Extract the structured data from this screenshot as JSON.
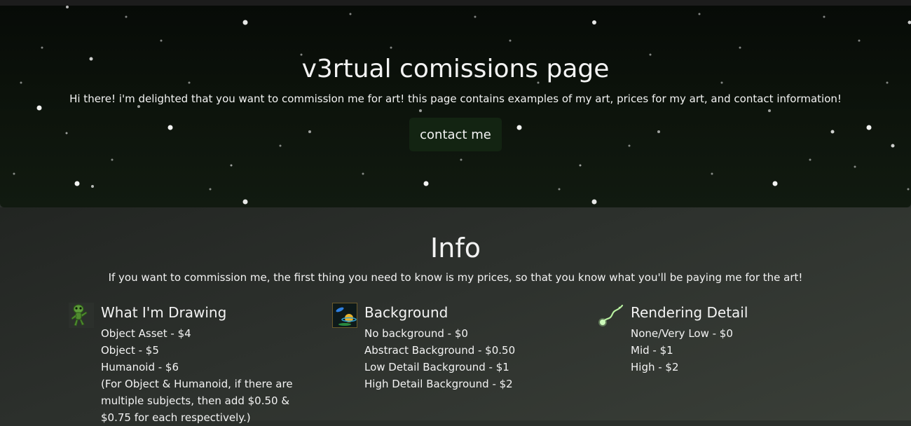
{
  "hero": {
    "title": "v3rtual comissions page",
    "subtitle": "Hi there! i'm delighted that you want to commission me for art! this page contains examples of my art, prices for my art, and contact information!",
    "contact_label": "contact me"
  },
  "info": {
    "title": "Info",
    "subtitle": "If you want to commission me, the first thing you need to know is my prices, so that you know what you'll be paying me for the art!",
    "columns": [
      {
        "icon": "alien-icon",
        "heading": "What I'm Drawing",
        "items": [
          "Object Asset - $4",
          "Object - $5",
          "Humanoid - $6",
          "(For Object & Humanoid, if there are multiple subjects, then add $0.50 & $0.75 for each respectively.)"
        ]
      },
      {
        "icon": "planet-icon",
        "heading": "Background",
        "items": [
          "No background - $0",
          "Abstract Background - $0.50",
          "Low Detail Background - $1",
          "High Detail Background - $2"
        ]
      },
      {
        "icon": "comet-icon",
        "heading": "Rendering Detail",
        "items": [
          "None/Very Low - $0",
          "Mid - $1",
          "High - $2"
        ]
      }
    ]
  },
  "colors": {
    "hero_bg": "#0d140c",
    "button_bg": "#132412",
    "info_bg": "#2d312d",
    "text": "#f3f3f3"
  }
}
